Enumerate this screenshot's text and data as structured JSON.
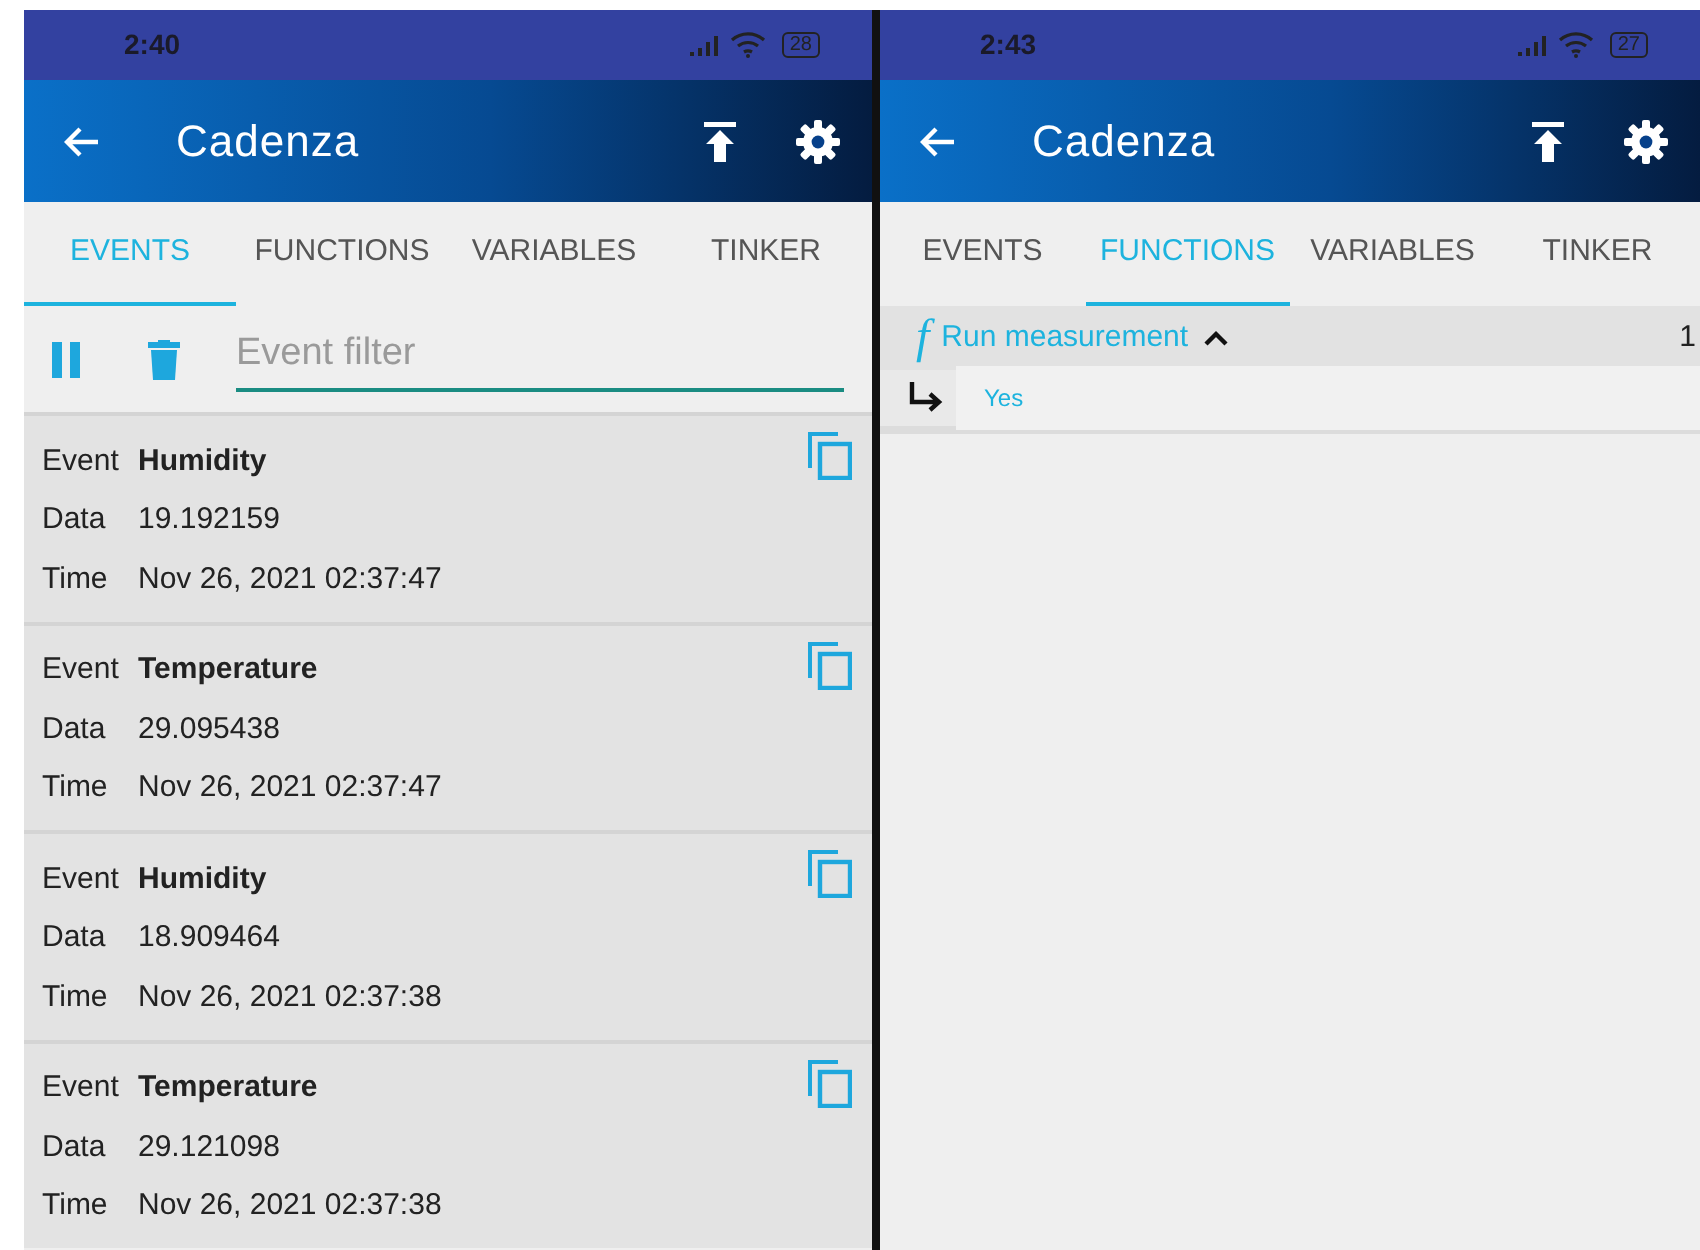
{
  "screens": [
    {
      "kind": "events",
      "status_bar": {
        "time": "2:40",
        "battery": "28"
      },
      "app_bar": {
        "title": "Cadenza"
      },
      "tabs": [
        {
          "label": "EVENTS",
          "selected": true
        },
        {
          "label": "FUNCTIONS",
          "selected": false
        },
        {
          "label": "VARIABLES",
          "selected": false
        },
        {
          "label": "TINKER",
          "selected": false
        }
      ],
      "filter": {
        "placeholder": "Event filter"
      },
      "events": [
        {
          "event_label": "Event",
          "event": "Humidity",
          "data_label": "Data",
          "data": "19.192159",
          "time_label": "Time",
          "time": "Nov 26, 2021 02:37:47"
        },
        {
          "event_label": "Event",
          "event": "Temperature",
          "data_label": "Data",
          "data": "29.095438",
          "time_label": "Time",
          "time": "Nov 26, 2021 02:37:47"
        },
        {
          "event_label": "Event",
          "event": "Humidity",
          "data_label": "Data",
          "data": "18.909464",
          "time_label": "Time",
          "time": "Nov 26, 2021 02:37:38"
        },
        {
          "event_label": "Event",
          "event": "Temperature",
          "data_label": "Data",
          "data": "29.121098",
          "time_label": "Time",
          "time": "Nov 26, 2021 02:37:38"
        }
      ]
    },
    {
      "kind": "functions",
      "status_bar": {
        "time": "2:43",
        "battery": "27"
      },
      "app_bar": {
        "title": "Cadenza"
      },
      "tabs": [
        {
          "label": "EVENTS",
          "selected": false
        },
        {
          "label": "FUNCTIONS",
          "selected": true
        },
        {
          "label": "VARIABLES",
          "selected": false
        },
        {
          "label": "TINKER",
          "selected": false
        }
      ],
      "functions": [
        {
          "symbol": "f",
          "name": "Run measurement",
          "expanded": true,
          "result": "1",
          "argument": "Yes"
        }
      ]
    }
  ]
}
